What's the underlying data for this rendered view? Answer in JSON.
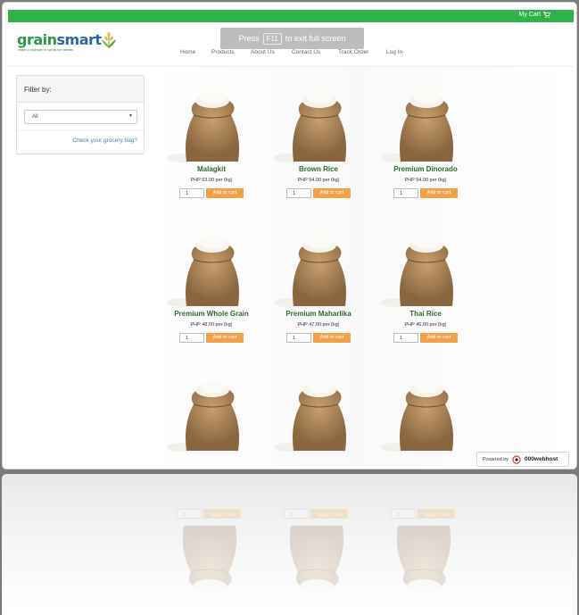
{
  "topbar": {
    "cart_label": "My Cart"
  },
  "brand": {
    "name_part1": "grain",
    "name_part2": "smart",
    "tagline": "retailer & wholesaler of special rice varieties"
  },
  "fullscreen_notice": {
    "prefix": "Press",
    "key": "F11",
    "suffix": "to exit full screen"
  },
  "nav": [
    "Home",
    "Products",
    "About Us",
    "Contact Us",
    "Track Order",
    "Log In"
  ],
  "sidebar": {
    "title": "Filter by:",
    "filter_value": "All",
    "check_link": "Check your grocery bag?"
  },
  "products": [
    {
      "name": "Malagkit",
      "price": "PHP 63.00 per (kg)",
      "qty": "1",
      "button": "Add to cart"
    },
    {
      "name": "Brown Rice",
      "price": "PHP 54.00 per (kg)",
      "qty": "1",
      "button": "Add to cart"
    },
    {
      "name": "Premium Dinorado",
      "price": "PHP 54.00 per (kg)",
      "qty": "1",
      "button": "Add to cart"
    },
    {
      "name": "Premium Whole Grain",
      "price": "PHP 48.00 per (kg)",
      "qty": "1",
      "button": "Add to cart"
    },
    {
      "name": "Premium Maharlika",
      "price": "PHP 47.00 per (kg)",
      "qty": "1",
      "button": "Add to cart"
    },
    {
      "name": "Thai Rice",
      "price": "PHP 46.00 per (kg)",
      "qty": "1",
      "button": "Add to cart"
    },
    {
      "name": "",
      "price": "",
      "qty": "",
      "button": ""
    },
    {
      "name": "",
      "price": "",
      "qty": "",
      "button": ""
    },
    {
      "name": "",
      "price": "",
      "qty": "",
      "button": ""
    }
  ],
  "powered_by": {
    "label": "Powered by",
    "brand": "000webhost"
  },
  "colors": {
    "topbar": "#30b24a",
    "button": "#f0a24a",
    "product_name": "#2d6a2e",
    "link": "#3b7cc4"
  }
}
